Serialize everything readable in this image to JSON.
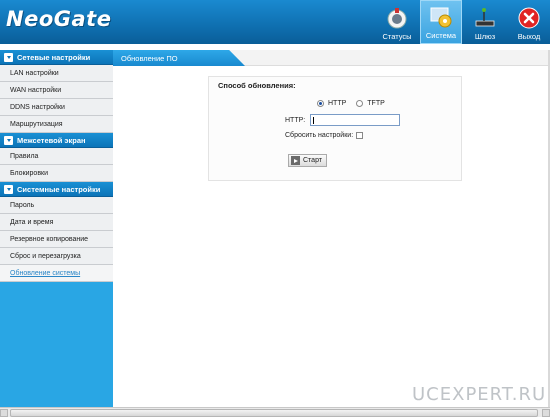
{
  "header": {
    "logo": "NeoGate",
    "nav": [
      {
        "label": "Статусы",
        "icon": "status-icon"
      },
      {
        "label": "Система",
        "icon": "system-icon",
        "active": true
      },
      {
        "label": "Шлюз",
        "icon": "gateway-icon"
      },
      {
        "label": "Выход",
        "icon": "exit-icon"
      }
    ]
  },
  "sidebar": {
    "sections": [
      {
        "title": "Сетевые настройки",
        "items": [
          "LAN настройки",
          "WAN настройки",
          "DDNS настройки",
          "Маршрутизация"
        ]
      },
      {
        "title": "Межсетевой экран",
        "items": [
          "Правила",
          "Блокировки"
        ]
      },
      {
        "title": "Системные настройки",
        "items": [
          "Пароль",
          "Дата и время",
          "Резервное копирование",
          "Сброс и перезагрузка",
          "Обновление системы"
        ]
      }
    ]
  },
  "main": {
    "tab": "Обновление ПО",
    "panel": {
      "title": "Способ обновления:",
      "option_http": "HTTP",
      "option_tftp": "TFTP",
      "selected": "HTTP",
      "http_label": "HTTP:",
      "http_value": "",
      "reset_label": "Сбросить настройки:",
      "reset_checked": false,
      "start_label": "Старт"
    }
  },
  "watermark": "UCEXPERT.RU",
  "colors": {
    "header": "#1a8ad0",
    "sidebar": "#29a6e4",
    "tab": "#2ea8e8"
  }
}
